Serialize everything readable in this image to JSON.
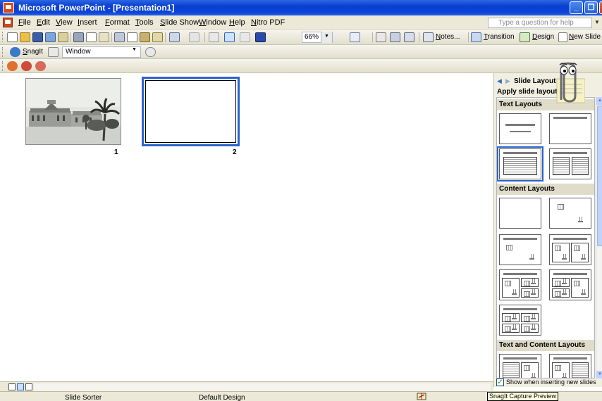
{
  "window": {
    "title": "Microsoft PowerPoint - [Presentation1]",
    "minimize_icon": "minimize-icon",
    "maximize_icon": "maximize-icon",
    "close_icon": "close-icon"
  },
  "menu": {
    "items": [
      "File",
      "Edit",
      "View",
      "Insert",
      "Format",
      "Tools",
      "Slide Show",
      "Window",
      "Help",
      "Nitro PDF"
    ],
    "help_placeholder": "Type a question for help"
  },
  "toolbar_standard": {
    "zoom": "66%",
    "notes_label": "Notes...",
    "transition_label": "Transition",
    "design_label": "Design",
    "new_slide_label": "New Slide"
  },
  "toolbar_snagit": {
    "snagit_label": "SnagIt",
    "capture_mode": "Window"
  },
  "slides": [
    {
      "number": "1",
      "has_image": true,
      "image_subject": "colonial building with palm tree (photo)"
    },
    {
      "number": "2",
      "has_image": false,
      "selected": true
    }
  ],
  "task_pane": {
    "title": "Slide Layout",
    "apply_label": "Apply slide layout:",
    "sections": [
      "Text Layouts",
      "Content Layouts",
      "Text and Content Layouts"
    ],
    "show_when_inserting_label": "Show when inserting new slides",
    "show_when_inserting_checked": true
  },
  "status": {
    "view": "Slide Sorter",
    "design": "Default Design",
    "tooltip": "SnagIt Capture Preview"
  },
  "colors": {
    "title_bar": "#0b44d8",
    "selection": "#2a63cd",
    "chrome": "#ece9d8"
  }
}
